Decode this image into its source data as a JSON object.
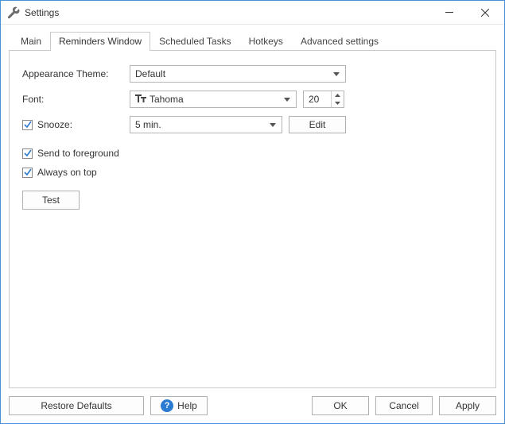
{
  "window": {
    "title": "Settings"
  },
  "tabs": [
    {
      "label": "Main"
    },
    {
      "label": "Reminders Window"
    },
    {
      "label": "Scheduled Tasks"
    },
    {
      "label": "Hotkeys"
    },
    {
      "label": "Advanced settings"
    }
  ],
  "active_tab_index": 1,
  "form": {
    "appearance_label": "Appearance Theme:",
    "appearance_value": "Default",
    "font_label": "Font:",
    "font_value": "Tahoma",
    "font_size_value": "20",
    "snooze_label": "Snooze:",
    "snooze_checked": true,
    "snooze_value": "5 min.",
    "edit_button": "Edit",
    "send_foreground_label": "Send to foreground",
    "send_foreground_checked": true,
    "always_on_top_label": "Always on top",
    "always_on_top_checked": true,
    "test_button": "Test"
  },
  "footer": {
    "restore_defaults": "Restore Defaults",
    "help": "Help",
    "ok": "OK",
    "cancel": "Cancel",
    "apply": "Apply"
  },
  "icons": {
    "app": "wrench-icon",
    "font_type": "font-tt-icon",
    "help": "help-icon"
  },
  "colors": {
    "border": "#c9c9c9",
    "accent": "#4a90d9",
    "help_bg": "#2a7bd1"
  }
}
